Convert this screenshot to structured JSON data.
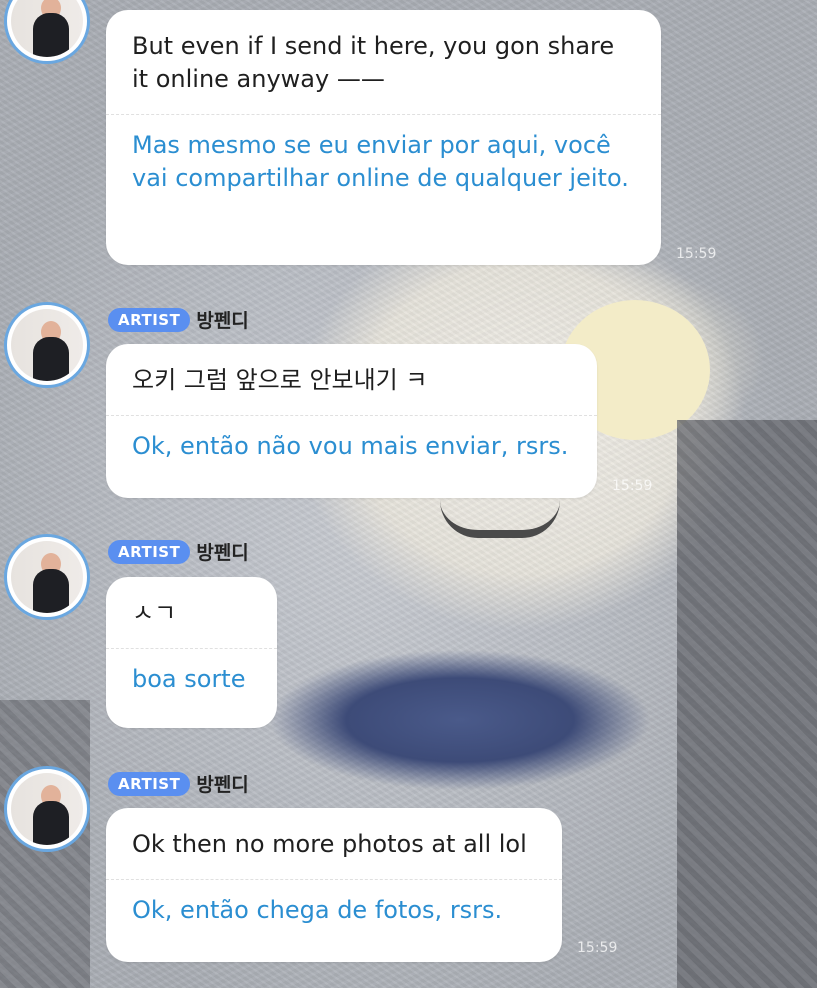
{
  "messages": [
    {
      "original": "But even if I send it here, you gon share it online anyway ——",
      "translation": "Mas mesmo se eu enviar por aqui, você vai compartilhar online de qualquer jeito.",
      "time": "15:59"
    },
    {
      "badge": "ARTIST",
      "sender": "방펜디",
      "original": "오키 그럼 앞으로 안보내기 ㅋ",
      "translation": "Ok, então não vou mais enviar, rsrs.",
      "time": "15:59"
    },
    {
      "badge": "ARTIST",
      "sender": "방펜디",
      "original": "ㅅㄱ",
      "translation": "boa sorte"
    },
    {
      "badge": "ARTIST",
      "sender": "방펜디",
      "original": "Ok then no more photos at all lol",
      "translation": "Ok, então chega de fotos, rsrs.",
      "time": "15:59"
    }
  ],
  "colors": {
    "badge": "#5a8ff0",
    "translation_text": "#2b8ed1",
    "avatar_ring": "#6aa7e0",
    "bubble": "#ffffff"
  }
}
